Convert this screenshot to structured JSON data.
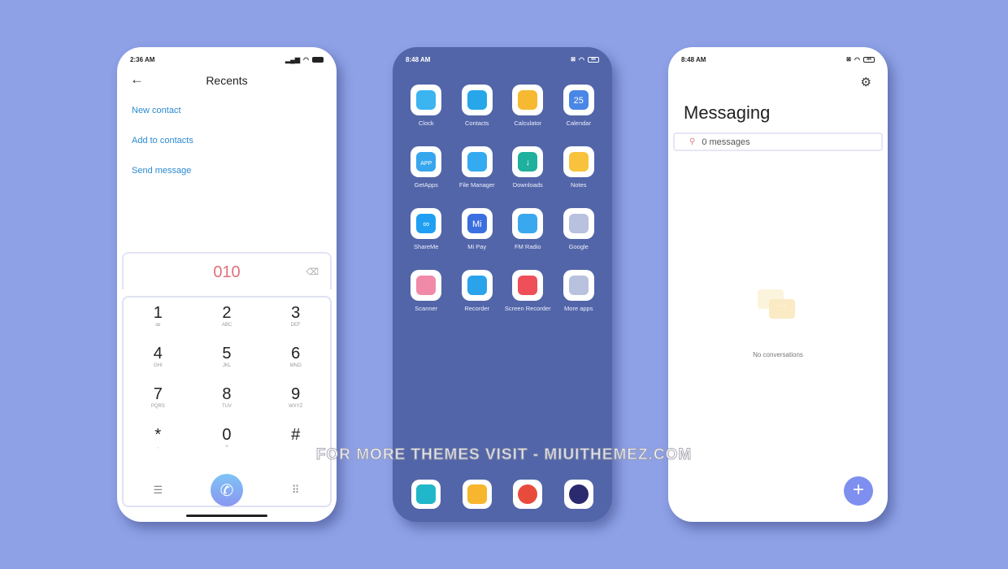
{
  "dialer": {
    "time": "2:36 AM",
    "title": "Recents",
    "actions": [
      "New contact",
      "Add to contacts",
      "Send message"
    ],
    "number": "010",
    "keys": [
      {
        "d": "1",
        "l": "ꝏ"
      },
      {
        "d": "2",
        "l": "ABC"
      },
      {
        "d": "3",
        "l": "DEF"
      },
      {
        "d": "4",
        "l": "GHI"
      },
      {
        "d": "5",
        "l": "JKL"
      },
      {
        "d": "6",
        "l": "MNO"
      },
      {
        "d": "7",
        "l": "PQRS"
      },
      {
        "d": "8",
        "l": "TUV"
      },
      {
        "d": "9",
        "l": "WXYZ"
      },
      {
        "d": "*",
        "l": ","
      },
      {
        "d": "0",
        "l": "+"
      },
      {
        "d": "#",
        "l": ""
      }
    ]
  },
  "home": {
    "time": "8:48 AM",
    "battery": "84",
    "apps": [
      {
        "label": "Clock",
        "color": "#3bb4f0",
        "icon": "drop-icon"
      },
      {
        "label": "Contacts",
        "color": "#27a6ea",
        "icon": "person-icon"
      },
      {
        "label": "Calculator",
        "color": "#f7b932",
        "icon": "equals-icon"
      },
      {
        "label": "Calendar",
        "color": "#4a86e6",
        "icon": "calendar-icon",
        "glyph": "25"
      },
      {
        "label": "GetApps",
        "color": "#36a6ee",
        "icon": "bag-icon",
        "glyph": "APP"
      },
      {
        "label": "File Manager",
        "color": "#34aaf0",
        "icon": "folder-icon"
      },
      {
        "label": "Downloads",
        "color": "#1fb09e",
        "icon": "download-icon",
        "glyph": "↓"
      },
      {
        "label": "Notes",
        "color": "#f8c23c",
        "icon": "bookmark-icon"
      },
      {
        "label": "ShareMe",
        "color": "#1e9ff2",
        "icon": "infinity-icon",
        "glyph": "∞"
      },
      {
        "label": "Mi Pay",
        "color": "#3b6fe0",
        "icon": "mipay-icon",
        "glyph": "Mi"
      },
      {
        "label": "FM Radio",
        "color": "#39a8ef",
        "icon": "radio-icon"
      },
      {
        "label": "Google",
        "color": "#b8c1de",
        "icon": "folder-google-icon"
      },
      {
        "label": "Scanner",
        "color": "#f08aa8",
        "icon": "qr-icon"
      },
      {
        "label": "Recorder",
        "color": "#2aa3ea",
        "icon": "recorder-icon"
      },
      {
        "label": "Screen Recorder",
        "color": "#ee4f58",
        "icon": "camera-icon"
      },
      {
        "label": "More apps",
        "color": "#b8c1de",
        "icon": "folder-more-icon"
      }
    ],
    "dock": [
      {
        "icon": "phone-icon",
        "color": "#1fb7c9",
        "glyph": "✆"
      },
      {
        "icon": "message-icon",
        "color": "#f7b62e"
      },
      {
        "icon": "chrome-icon",
        "color": "#e84b3c"
      },
      {
        "icon": "camera-lens-icon",
        "color": "#2b2a6e"
      }
    ]
  },
  "messaging": {
    "time": "8:48 AM",
    "battery": "84",
    "title": "Messaging",
    "search_placeholder": "0 messages",
    "empty_text": "No conversations"
  },
  "watermark": "FOR MORE THEMES VISIT - MIUITHEMEZ.COM",
  "colors": {
    "background": "#8ea1e6",
    "home_bg": "#5265a8",
    "accent": "#7f8ff0",
    "link": "#2b8ad0",
    "number": "#e0707a"
  }
}
